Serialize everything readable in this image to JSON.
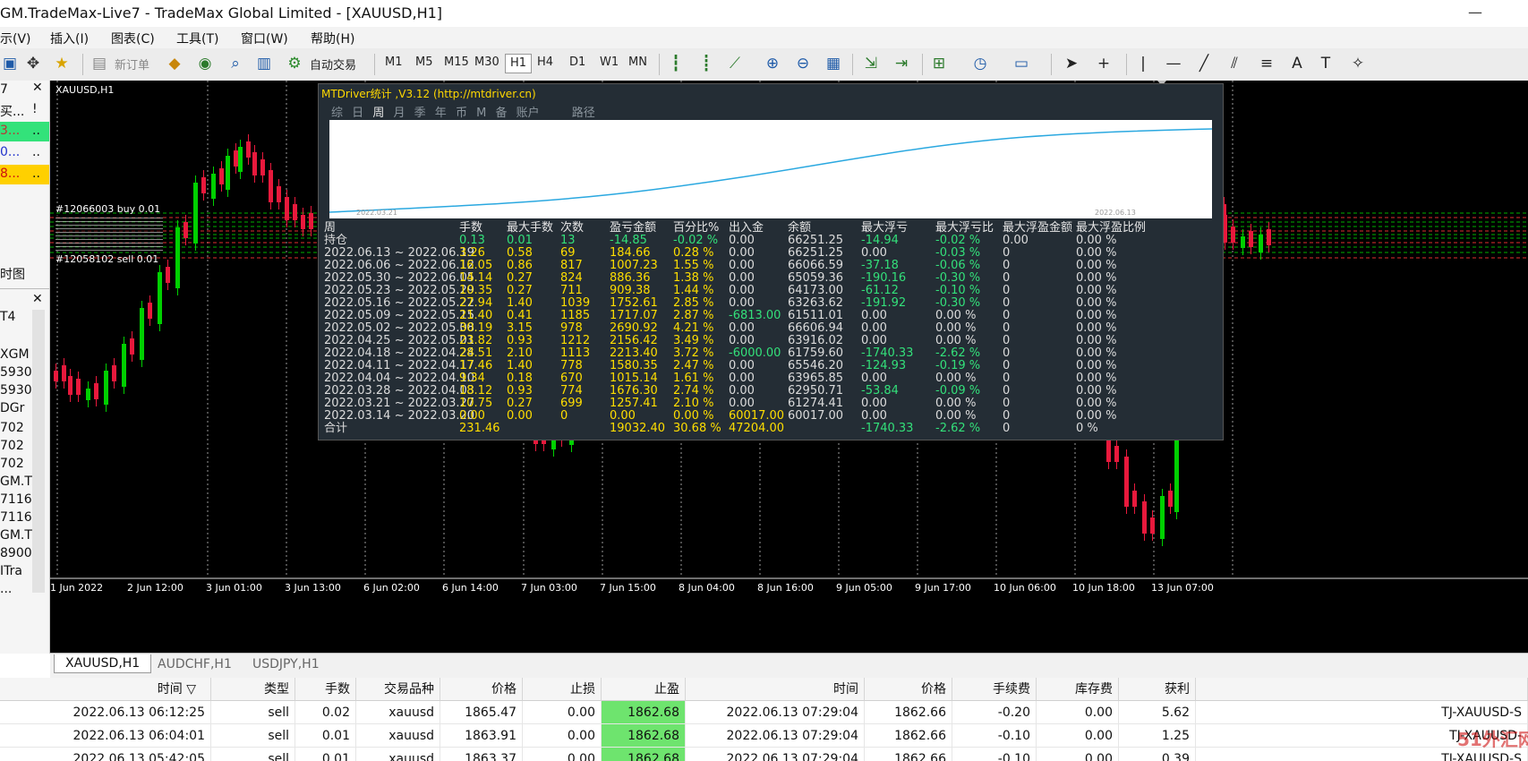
{
  "window": {
    "title": "GM.TradeMax-Live7 - TradeMax Global Limited - [XAUUSD,H1]"
  },
  "menu": [
    "示(V)",
    "插入(I)",
    "图表(C)",
    "工具(T)",
    "窗口(W)",
    "帮助(H)"
  ],
  "toolbar": {
    "new_order": "新订单",
    "auto_trade": "自动交易",
    "timeframes": [
      "M1",
      "M5",
      "M15",
      "M30",
      "H1",
      "H4",
      "D1",
      "W1",
      "MN"
    ],
    "active_timeframe": "H1"
  },
  "left": {
    "panel1_top": "7",
    "panel1_rows": [
      "买...",
      "3...",
      "0...",
      "8..."
    ],
    "panel1_extra": "!",
    "panel1_dots": [
      "..",
      "..",
      ".."
    ],
    "time_tab": "时图",
    "panel2_top": "T4",
    "panel2_rows": [
      "XGM",
      "5930",
      "5930",
      "DGr",
      "702",
      "702",
      "702",
      "GM.T",
      "7116",
      "7116",
      "GM.T",
      "8900",
      "ITra",
      "..."
    ]
  },
  "chart": {
    "symbol_label": "XAUUSD,H1",
    "time_labels": [
      "1 Jun 2022",
      "2 Jun 12:00",
      "3 Jun 01:00",
      "3 Jun 13:00",
      "6 Jun 02:00",
      "6 Jun 14:00",
      "7 Jun 03:00",
      "7 Jun 15:00",
      "8 Jun 04:00",
      "8 Jun 16:00",
      "9 Jun 05:00",
      "9 Jun 17:00",
      "10 Jun 06:00",
      "10 Jun 18:00",
      "13 Jun 07:00"
    ],
    "trade_labels": [
      "#12066003 buy 0.01",
      "#12058102 sell 0.01"
    ],
    "colors": {
      "bull": "#00d000",
      "bear": "#e8193c",
      "grid": "#9a9a9a"
    }
  },
  "mtdriver": {
    "title": "MTDriver统计 ,V3.12 (http://mtdriver.cn)",
    "tabs": [
      "综",
      "日",
      "周",
      "月",
      "季",
      "年",
      "币",
      "M",
      "备",
      "账户",
      "",
      "路径"
    ],
    "active_tab": "周",
    "curve_start": "2022.03.21",
    "curve_end": "2022.06.13",
    "headers": [
      "周",
      "手数",
      "最大手数",
      "次数",
      "盈亏金额",
      "百分比%",
      "出入金",
      "余额",
      "最大浮亏",
      "最大浮亏比",
      "最大浮盈金额",
      "最大浮盈比例"
    ],
    "holding": [
      "持仓",
      "0.13",
      "0.01",
      "13",
      "-14.85",
      "-0.02 %",
      "0.00",
      "66251.25",
      "-14.94",
      "-0.02 %",
      "0.00",
      "0.00 %"
    ],
    "rows": [
      [
        "2022.06.13 ~ 2022.06.19",
        "3.26",
        "0.58",
        "69",
        "184.66",
        "0.28 %",
        "0.00",
        "66251.25",
        "0.00",
        "-0.03 %",
        "0",
        "0.00 %"
      ],
      [
        "2022.06.06 ~ 2022.06.12",
        "16.05",
        "0.86",
        "817",
        "1007.23",
        "1.55 %",
        "0.00",
        "66066.59",
        "-37.18",
        "-0.06 %",
        "0",
        "0.00 %"
      ],
      [
        "2022.05.30 ~ 2022.06.05",
        "14.14",
        "0.27",
        "824",
        "886.36",
        "1.38 %",
        "0.00",
        "65059.36",
        "-190.16",
        "-0.30 %",
        "0",
        "0.00 %"
      ],
      [
        "2022.05.23 ~ 2022.05.29",
        "10.35",
        "0.27",
        "711",
        "909.38",
        "1.44 %",
        "0.00",
        "64173.00",
        "-61.12",
        "-0.10 %",
        "0",
        "0.00 %"
      ],
      [
        "2022.05.16 ~ 2022.05.22",
        "27.94",
        "1.40",
        "1039",
        "1752.61",
        "2.85 %",
        "0.00",
        "63263.62",
        "-191.92",
        "-0.30 %",
        "0",
        "0.00 %"
      ],
      [
        "2022.05.09 ~ 2022.05.15",
        "21.40",
        "0.41",
        "1185",
        "1717.07",
        "2.87 %",
        "-6813.00",
        "61511.01",
        "0.00",
        "0.00 %",
        "0",
        "0.00 %"
      ],
      [
        "2022.05.02 ~ 2022.05.08",
        "30.19",
        "3.15",
        "978",
        "2690.92",
        "4.21 %",
        "0.00",
        "66606.94",
        "0.00",
        "0.00 %",
        "0",
        "0.00 %"
      ],
      [
        "2022.04.25 ~ 2022.05.01",
        "23.82",
        "0.93",
        "1212",
        "2156.42",
        "3.49 %",
        "0.00",
        "63916.02",
        "0.00",
        "0.00 %",
        "0",
        "0.00 %"
      ],
      [
        "2022.04.18 ~ 2022.04.24",
        "28.51",
        "2.10",
        "1113",
        "2213.40",
        "3.72 %",
        "-6000.00",
        "61759.60",
        "-1740.33",
        "-2.62 %",
        "0",
        "0.00 %"
      ],
      [
        "2022.04.11 ~ 2022.04.17",
        "17.46",
        "1.40",
        "778",
        "1580.35",
        "2.47 %",
        "0.00",
        "65546.20",
        "-124.93",
        "-0.19 %",
        "0",
        "0.00 %"
      ],
      [
        "2022.04.04 ~ 2022.04.10",
        "9.34",
        "0.18",
        "670",
        "1015.14",
        "1.61 %",
        "0.00",
        "63965.85",
        "0.00",
        "0.00 %",
        "0",
        "0.00 %"
      ],
      [
        "2022.03.28 ~ 2022.04.03",
        "18.12",
        "0.93",
        "774",
        "1676.30",
        "2.74 %",
        "0.00",
        "62950.71",
        "-53.84",
        "-0.09 %",
        "0",
        "0.00 %"
      ],
      [
        "2022.03.21 ~ 2022.03.27",
        "10.75",
        "0.27",
        "699",
        "1257.41",
        "2.10 %",
        "0.00",
        "61274.41",
        "0.00",
        "0.00 %",
        "0",
        "0.00 %"
      ],
      [
        "2022.03.14 ~ 2022.03.20",
        "0.00",
        "0.00",
        "0",
        "0.00",
        "0.00 %",
        "60017.00",
        "60017.00",
        "0.00",
        "0.00 %",
        "0",
        "0.00 %"
      ]
    ],
    "total": [
      "合计",
      "231.46",
      "",
      "",
      "19032.40",
      "30.68 %",
      "47204.00",
      "",
      "-1740.33",
      "-2.62 %",
      "0",
      "0 %"
    ]
  },
  "chart_tabs": [
    "XAUUSD,H1",
    "AUDCHF,H1",
    "USDJPY,H1"
  ],
  "trades": {
    "headers": [
      "时间",
      "类型",
      "手数",
      "交易品种",
      "价格",
      "止损",
      "止盈",
      "时间",
      "价格",
      "手续费",
      "库存费",
      "获利",
      ""
    ],
    "sort_icon": "▽",
    "rows": [
      [
        "2022.06.13 06:12:25",
        "sell",
        "0.02",
        "xauusd",
        "1865.47",
        "0.00",
        "1862.68",
        "2022.06.13 07:29:04",
        "1862.66",
        "-0.20",
        "0.00",
        "5.62",
        "TJ-XAUUSD-S"
      ],
      [
        "2022.06.13 06:04:01",
        "sell",
        "0.01",
        "xauusd",
        "1863.91",
        "0.00",
        "1862.68",
        "2022.06.13 07:29:04",
        "1862.66",
        "-0.10",
        "0.00",
        "1.25",
        "TJ-XAUUSD-"
      ],
      [
        "2022.06.13 05:42:05",
        "sell",
        "0.01",
        "xauusd",
        "1863.37",
        "0.00",
        "1862.68",
        "2022.06.13 07:29:04",
        "1862.66",
        "-0.10",
        "0.00",
        "0.39",
        "TJ-XAUUSD-S"
      ]
    ]
  },
  "watermark": "51外汇网"
}
